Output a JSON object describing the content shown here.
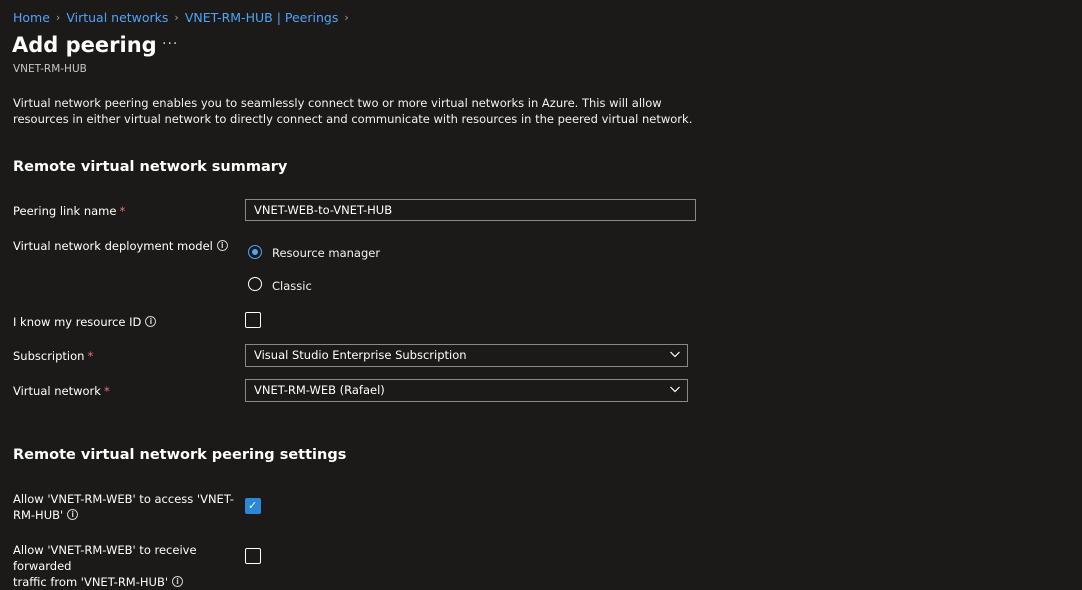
{
  "breadcrumb": {
    "items": [
      "Home",
      "Virtual networks",
      "VNET-RM-HUB | Peerings"
    ],
    "separator": "›"
  },
  "page": {
    "title": "Add peering",
    "more_label": "···",
    "subtitle": "VNET-RM-HUB",
    "description": "Virtual network peering enables you to seamlessly connect two or more virtual networks in Azure. This will allow resources in either virtual network to directly connect and communicate with resources in the peered virtual network."
  },
  "remote_summary": {
    "heading": "Remote virtual network summary",
    "peering_link_name": {
      "label": "Peering link name",
      "required_mark": "*",
      "value": "VNET-WEB-to-VNET-HUB"
    },
    "deployment_model": {
      "label": "Virtual network deployment model",
      "info_glyph": "i",
      "options": [
        "Resource manager",
        "Classic"
      ],
      "selected": "Resource manager"
    },
    "know_resource_id": {
      "label": "I know my resource ID",
      "info_glyph": "i",
      "checked": false
    },
    "subscription": {
      "label": "Subscription",
      "required_mark": "*",
      "value": "Visual Studio Enterprise Subscription"
    },
    "virtual_network": {
      "label": "Virtual network",
      "required_mark": "*",
      "value": "VNET-RM-WEB (Rafael)"
    }
  },
  "peering_settings": {
    "heading": "Remote virtual network peering settings",
    "allow_access": {
      "label_line1": "Allow 'VNET-RM-WEB' to access 'VNET-",
      "label_line2": "RM-HUB'",
      "info_glyph": "i",
      "checked": true,
      "check_glyph": "✓"
    },
    "allow_forwarded": {
      "label_line1": "Allow 'VNET-RM-WEB' to receive forwarded",
      "label_line2": "traffic from 'VNET-RM-HUB'",
      "info_glyph": "i",
      "checked": false
    }
  },
  "icons": {
    "chevron": "chevron-down-icon",
    "info": "info-icon",
    "more": "more-icon"
  },
  "colors": {
    "background": "#1b1a19",
    "link": "#4fa3f7",
    "required": "#f1707b",
    "checkbox_checked": "#2b88d8",
    "border": "#8a8886"
  }
}
